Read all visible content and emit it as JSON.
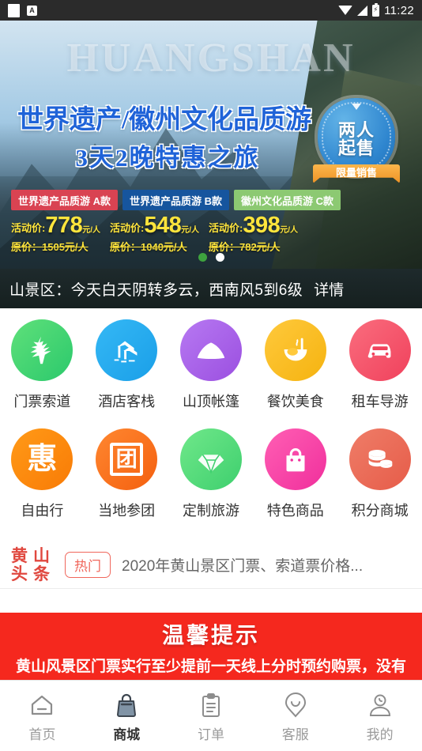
{
  "statusbar": {
    "notification_icon": "note-icon",
    "app_icon": "a-badge-icon",
    "wifi_icon": "wifi-icon",
    "signal_icon": "signal-icon",
    "battery_icon": "battery-charging-icon",
    "clock": "11:22"
  },
  "hero": {
    "watermark": "HUANGSHAN",
    "headline": "世界遗产/徽州文化品质游",
    "subheadline": "3天2晚特惠之旅",
    "badge": {
      "line1": "两人",
      "line2": "起售",
      "ribbon": "限量销售",
      "gem_icon": "diamond-icon"
    },
    "packages": [
      {
        "tag": "世界遗产品质游 A款",
        "tag_color": "#d94352",
        "price_label": "活动价:",
        "price": "778",
        "unit": "元/人",
        "original": "原价：1505元/人"
      },
      {
        "tag": "世界遗产品质游 B款",
        "tag_color": "#16559e",
        "price_label": "活动价:",
        "price": "548",
        "unit": "元/人",
        "original": "原价：1040元/人"
      },
      {
        "tag": "徽州文化品质游 C款",
        "tag_color": "#8cc972",
        "price_label": "活动价:",
        "price": "398",
        "unit": "元/人",
        "original": "原价：782元/人"
      }
    ],
    "carousel_dots": [
      {
        "color": "#3ea33e",
        "active": false
      },
      {
        "color": "#ffffff",
        "active": true
      }
    ]
  },
  "weather": {
    "text": "山景区：今天白天阴转多云，西南风5到6级",
    "more": "详情"
  },
  "grid": {
    "row1": [
      {
        "label": "门票索道",
        "icon": "pine-tree-icon",
        "c1": "#5fe07a",
        "c2": "#2bc96c"
      },
      {
        "label": "酒店客栈",
        "icon": "house-icon",
        "c1": "#35b8f5",
        "c2": "#1a9fe8"
      },
      {
        "label": "山顶帐篷",
        "icon": "tent-icon",
        "c1": "#b779f2",
        "c2": "#9b4fe0"
      },
      {
        "label": "餐饮美食",
        "icon": "bowl-icon",
        "c1": "#ffc93c",
        "c2": "#f5b310"
      },
      {
        "label": "租车导游",
        "icon": "car-icon",
        "c1": "#fa6d7e",
        "c2": "#f0415c"
      }
    ],
    "row2": [
      {
        "label": "自由行",
        "icon": "hui-char-icon",
        "char": "惠",
        "c1": "#ff9a17",
        "c2": "#f97b06"
      },
      {
        "label": "当地参团",
        "icon": "tuan-char-icon",
        "char": "团",
        "c1": "#ff8730",
        "c2": "#f4600f"
      },
      {
        "label": "定制旅游",
        "icon": "diamond-icon",
        "c1": "#70e88a",
        "c2": "#3ecf6e"
      },
      {
        "label": "特色商品",
        "icon": "shopping-bag-icon",
        "c1": "#ff5fb4",
        "c2": "#f02f9c"
      },
      {
        "label": "积分商城",
        "icon": "coins-icon",
        "c1": "#ef7d68",
        "c2": "#e65c49"
      }
    ]
  },
  "news": {
    "logo": [
      "黄",
      "山",
      "头",
      "条"
    ],
    "hot_badge": "热门",
    "title": "2020年黄山景区门票、索道票价格..."
  },
  "notice": {
    "heading": "温馨提示",
    "body": "黄山风景区门票实行至少提前一天线上分时预约购票，没有"
  },
  "tabbar": [
    {
      "label": "首页",
      "icon": "home-icon",
      "active": false
    },
    {
      "label": "商城",
      "icon": "shop-bag-icon",
      "active": true
    },
    {
      "label": "订单",
      "icon": "clipboard-icon",
      "active": false
    },
    {
      "label": "客服",
      "icon": "smiley-pin-icon",
      "active": false
    },
    {
      "label": "我的",
      "icon": "user-icon",
      "active": false
    }
  ]
}
